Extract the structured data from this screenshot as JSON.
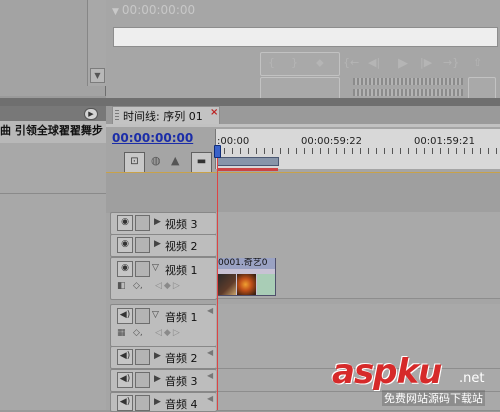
{
  "program_monitor": {
    "timecode": "00:00:00:00",
    "controls": [
      "{",
      "}",
      "⬥",
      "{←",
      "◀|",
      "▶",
      "|▶",
      "→}",
      "⇧"
    ]
  },
  "project_panel": {
    "title": "曲 引领全球翟翟舞步"
  },
  "timeline": {
    "tab_label": "时间线: 序列 01",
    "close_glyph": "×",
    "current_timecode": "00:00:00:00",
    "ruler_labels": [
      ":00:00",
      "00:00:59:22",
      "00:01:59:21"
    ],
    "tracks": [
      {
        "name": "视频 3",
        "kind": "video",
        "expanded": false
      },
      {
        "name": "视频 2",
        "kind": "video",
        "expanded": false
      },
      {
        "name": "视频 1",
        "kind": "video",
        "expanded": true
      },
      {
        "name": "音频 1",
        "kind": "audio",
        "expanded": true
      },
      {
        "name": "音频 2",
        "kind": "audio",
        "expanded": false
      },
      {
        "name": "音频 3",
        "kind": "audio",
        "expanded": false
      },
      {
        "name": "音频 4",
        "kind": "audio",
        "expanded": false
      }
    ],
    "clip": {
      "title": "0001.奇艺0"
    }
  },
  "watermark": {
    "brand": "aspku",
    "tld": ".net",
    "subtitle": "免费网站源码下载站"
  },
  "colors": {
    "timecode_blue": "#1b2da8",
    "playhead_red": "#dd4444",
    "watermark_red": "#d62a2a"
  }
}
